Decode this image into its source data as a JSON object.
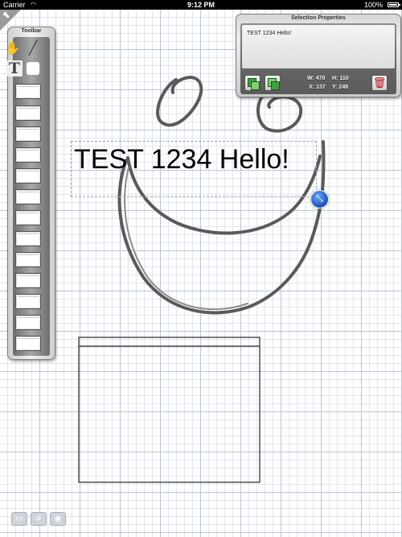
{
  "status_bar": {
    "carrier": "Carrier",
    "time": "9:12 PM",
    "battery": "100%",
    "wifi_icon": "wifi-icon",
    "battery_icon": "battery-icon"
  },
  "back_corner": {
    "icon": "back-arrow-icon"
  },
  "toolbar": {
    "title": "Toolbar",
    "tools": [
      "hand-icon",
      "pen-icon",
      "text-icon",
      "rounded-rect-icon"
    ],
    "swatch_count": 13
  },
  "canvas": {
    "selected_text": "TEST 1234 Hello!",
    "handle_icon": "resize-handle-icon"
  },
  "selection_properties": {
    "title": "Selection Properties",
    "text_value": "TEST 1234 Hello!",
    "width": "W: 470",
    "height": "H: 110",
    "x": "X: 137",
    "y": "Y: 248",
    "bring_forward_icon": "bring-forward-icon",
    "send_backward_icon": "send-backward-icon",
    "delete_icon": "trash-icon"
  },
  "bottom_bar": {
    "icons": [
      "display-icon",
      "grid-icon",
      "eye-icon"
    ]
  },
  "colors": {
    "grid_major": "#b8c6dc",
    "grid_minor": "#e1e7f1",
    "stroke": "#555555",
    "handle": "#1a4fb7",
    "delete": "#c0121f"
  }
}
